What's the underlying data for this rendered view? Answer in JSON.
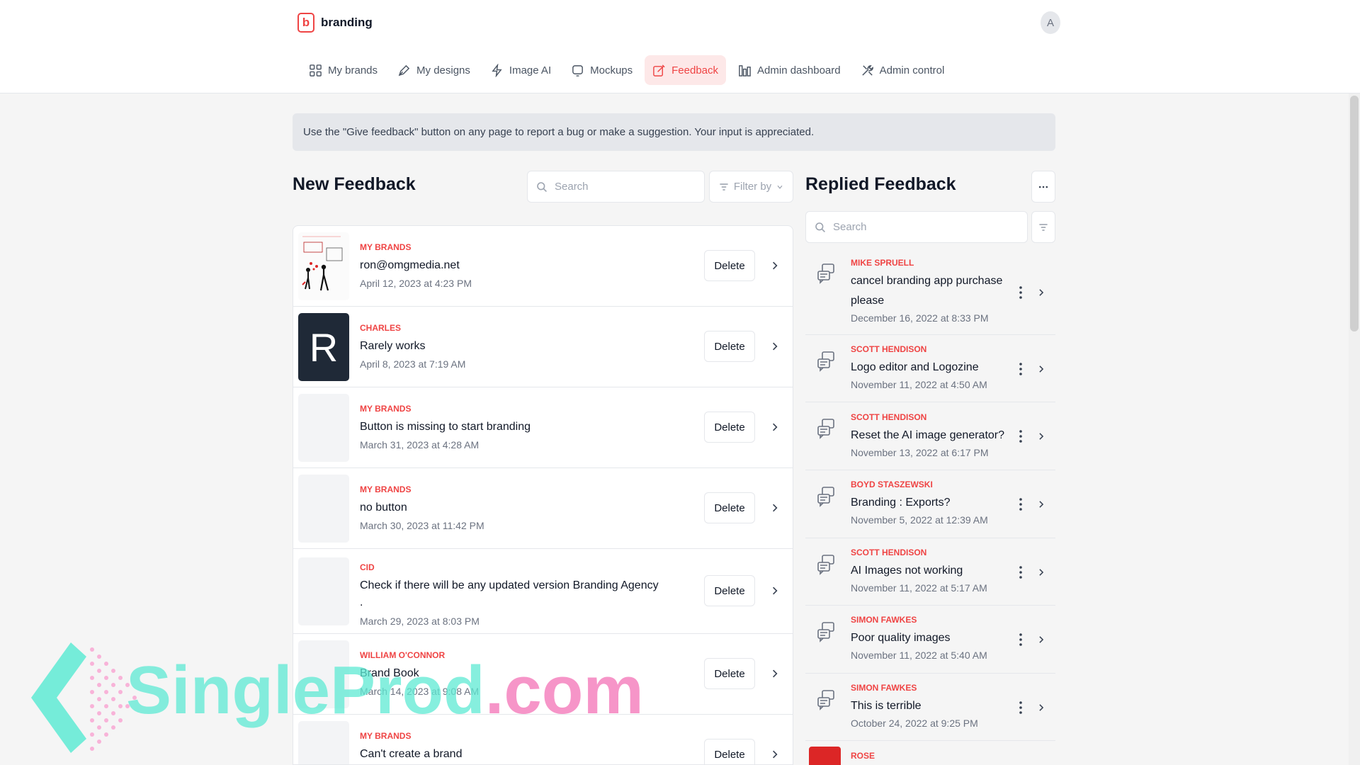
{
  "app": {
    "name": "branding",
    "logo_letter": "b",
    "avatar_letter": "A"
  },
  "nav": [
    {
      "label": "My brands",
      "icon": "grid-icon"
    },
    {
      "label": "My designs",
      "icon": "pen-icon"
    },
    {
      "label": "Image AI",
      "icon": "bolt-icon"
    },
    {
      "label": "Mockups",
      "icon": "device-icon"
    },
    {
      "label": "Feedback",
      "icon": "edit-icon",
      "active": true
    },
    {
      "label": "Admin dashboard",
      "icon": "chart-icon"
    },
    {
      "label": "Admin control",
      "icon": "tools-icon"
    }
  ],
  "banner": "Use the \"Give feedback\" button on any page to report a bug or make a suggestion. Your input is appreciated.",
  "new_feedback": {
    "title": "New Feedback",
    "search_placeholder": "Search",
    "filter_label": "Filter by",
    "delete_label": "Delete",
    "items": [
      {
        "category": "MY BRANDS",
        "title": "ron@omgmedia.net",
        "date": "April 12, 2023 at 4:23 PM",
        "thumb": "sketch"
      },
      {
        "category": "CHARLES",
        "title": "Rarely works",
        "date": "April 8, 2023 at 7:19 AM",
        "thumb": "R"
      },
      {
        "category": "MY BRANDS",
        "title": "Button is missing to start branding",
        "date": "March 31, 2023 at 4:28 AM",
        "thumb": ""
      },
      {
        "category": "MY BRANDS",
        "title": "no button",
        "date": "March 30, 2023 at 11:42 PM",
        "thumb": ""
      },
      {
        "category": "CID",
        "title": "Check if there will be any updated version Branding Agency",
        "title2": ".",
        "date": "March 29, 2023 at 8:03 PM",
        "thumb": ""
      },
      {
        "category": "WILLIAM O'CONNOR",
        "title": "Brand Book",
        "date": "March 14, 2023 at 9:08 AM",
        "thumb": ""
      },
      {
        "category": "MY BRANDS",
        "title": "Can't create a brand",
        "date": "",
        "thumb": ""
      }
    ]
  },
  "replied_feedback": {
    "title": "Replied Feedback",
    "search_placeholder": "Search",
    "items": [
      {
        "name": "MIKE SPRUELL",
        "title": "cancel branding app purchase please",
        "date": "December 16, 2022 at 8:33 PM"
      },
      {
        "name": "SCOTT HENDISON",
        "title": "Logo editor and Logozine",
        "date": "November 11, 2022 at 4:50 AM"
      },
      {
        "name": "SCOTT HENDISON",
        "title": "Reset the AI image generator?",
        "date": "November 13, 2022 at 6:17 PM"
      },
      {
        "name": "BOYD STASZEWSKI",
        "title": "Branding : Exports?",
        "date": "November 5, 2022 at 12:39 AM"
      },
      {
        "name": "SCOTT HENDISON",
        "title": "AI Images not working",
        "date": "November 11, 2022 at 5:17 AM"
      },
      {
        "name": "SIMON FAWKES",
        "title": "Poor quality images",
        "date": "November 11, 2022 at 5:40 AM"
      },
      {
        "name": "SIMON FAWKES",
        "title": "This is terrible",
        "date": "October 24, 2022 at 9:25 PM"
      },
      {
        "name": "ROSE",
        "title": "",
        "date": ""
      }
    ]
  },
  "watermark": {
    "part1": "SingleProd",
    "part2": ".com"
  },
  "colors": {
    "accent": "#ef4444",
    "accent_bg": "#fde8e8",
    "page_bg": "#f5f5f5",
    "banner_bg": "#e5e7eb"
  }
}
